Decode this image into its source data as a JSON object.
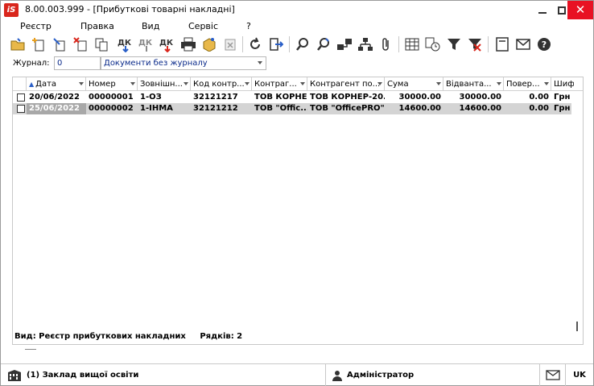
{
  "window": {
    "app_logo": "iS",
    "title": "8.00.003.999 - [Прибуткові товарні накладні]",
    "controls": {
      "minimize": "minimize-icon",
      "maximize": "maximize-icon",
      "close": "✕"
    }
  },
  "menu": [
    {
      "label": "Реєстр"
    },
    {
      "label": "Правка"
    },
    {
      "label": "Вид"
    },
    {
      "label": "Сервіс"
    },
    {
      "label": "?"
    }
  ],
  "toolbar": {
    "icons": [
      "open-folder-icon",
      "new-document-icon",
      "edit-document-icon",
      "delete-document-icon",
      "copy-document-icon",
      "post-document-icon",
      "unpost-document-icon",
      "cancel-post-icon",
      "print-icon",
      "package-icon",
      "export-icon",
      "refresh-icon",
      "exit-icon",
      "search-icon",
      "search-next-icon",
      "structure-icon",
      "hierarchy-icon",
      "attachment-icon",
      "table-icon",
      "schedule-icon",
      "filter-icon",
      "clear-filter-icon",
      "form-icon",
      "mail-icon",
      "help-icon"
    ],
    "colors": {
      "accent_red": "#d9261c",
      "accent_blue": "#2a5fc8",
      "icon_dark": "#333333"
    }
  },
  "journal": {
    "label": "Журнал:",
    "code": "0",
    "selected": "Документи без журналу"
  },
  "grid": {
    "columns": [
      {
        "label": "Дата",
        "sorted": true
      },
      {
        "label": "Номер"
      },
      {
        "label": "Зовнішн..."
      },
      {
        "label": "Код контр..."
      },
      {
        "label": "Контраг..."
      },
      {
        "label": "Контрагент по..."
      },
      {
        "label": "Сума"
      },
      {
        "label": "Відванта..."
      },
      {
        "label": "Повер..."
      },
      {
        "label": "Шиф"
      }
    ],
    "rows": [
      {
        "date": "20/06/2022",
        "number": "00000001",
        "external": "1-ОЗ",
        "code": "32121217",
        "counterparty": "ТОВ КОРНЕ...",
        "counterparty_full": "ТОВ КОРНЕР-20...",
        "sum": "30000.00",
        "shipped": "30000.00",
        "returned": "0.00",
        "cipher": "Грн",
        "selected": false
      },
      {
        "date": "25/06/2022",
        "number": "00000002",
        "external": "1-ІНМА",
        "code": "32121212",
        "counterparty": "ТОВ \"Offic...",
        "counterparty_full": "ТОВ \"OfficePRO\"",
        "sum": "14600.00",
        "shipped": "14600.00",
        "returned": "0.00",
        "cipher": "Грн",
        "selected": true
      }
    ],
    "footer_view": "Вид: Реєстр прибуткових накладних",
    "footer_rows": "Рядків: 2"
  },
  "status": {
    "org": "(1) Заклад вищої освіти",
    "user": "Адміністратор",
    "lang": "UK"
  }
}
